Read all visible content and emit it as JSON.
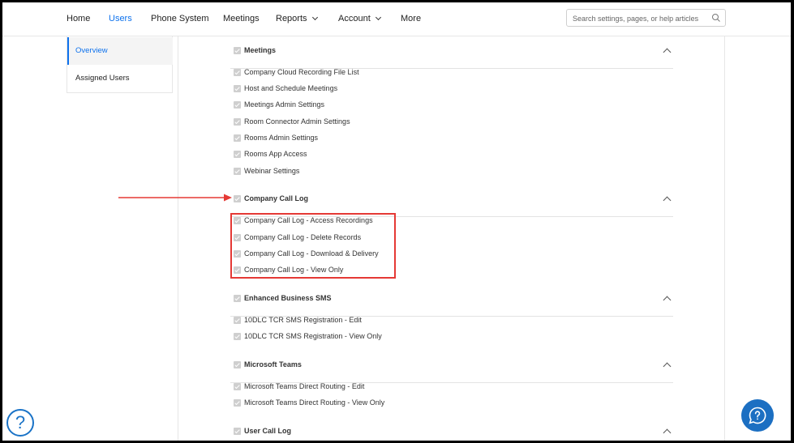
{
  "nav": {
    "items": [
      {
        "label": "Home"
      },
      {
        "label": "Users"
      },
      {
        "label": "Phone System"
      },
      {
        "label": "Meetings"
      },
      {
        "label": "Reports"
      },
      {
        "label": "Account"
      },
      {
        "label": "More"
      }
    ],
    "active": "Users",
    "search_placeholder": "Search settings, pages, or help articles"
  },
  "sidebar": {
    "items": [
      {
        "label": "Overview",
        "active": true
      },
      {
        "label": "Assigned Users",
        "active": false
      }
    ]
  },
  "groups": [
    {
      "title": "Meetings",
      "checked": true,
      "items": [
        "Company Cloud Recording File List",
        "Host and Schedule Meetings",
        "Meetings Admin Settings",
        "Room Connector Admin Settings",
        "Rooms Admin Settings",
        "Rooms App Access",
        "Webinar Settings"
      ]
    },
    {
      "title": "Company Call Log",
      "checked": true,
      "items": [
        "Company Call Log - Access Recordings",
        "Company Call Log - Delete Records",
        "Company Call Log - Download & Delivery",
        "Company Call Log - View Only"
      ]
    },
    {
      "title": "Enhanced Business SMS",
      "checked": true,
      "items": [
        "10DLC TCR SMS Registration - Edit",
        "10DLC TCR SMS Registration - View Only"
      ]
    },
    {
      "title": "Microsoft Teams",
      "checked": true,
      "items": [
        "Microsoft Teams Direct Routing - Edit",
        "Microsoft Teams Direct Routing - View Only"
      ]
    },
    {
      "title": "User Call Log",
      "checked": true,
      "items": []
    }
  ],
  "colors": {
    "accent": "#0e72ed",
    "annotation": "#e53935",
    "checkbox": "#cfcfcf"
  },
  "icons": {
    "help_left": "question-circle-icon",
    "help_right": "chat-help-icon"
  },
  "help_left_glyph": "?"
}
